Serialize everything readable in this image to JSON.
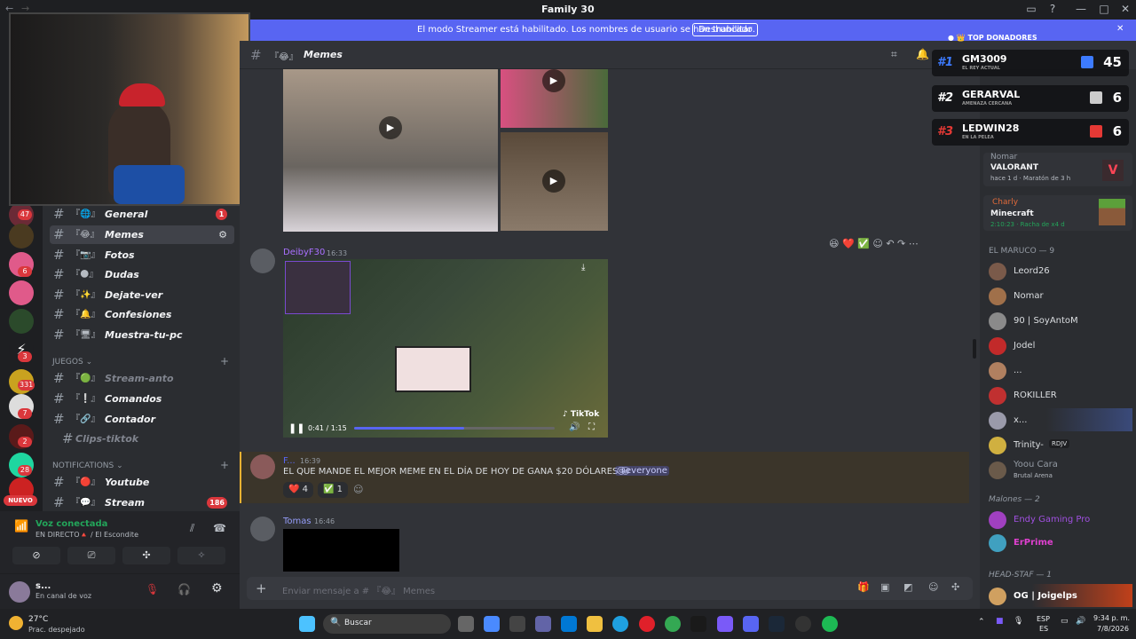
{
  "window": {
    "title": "Family 30"
  },
  "banner": {
    "text": "El modo Streamer está habilitado. Los nombres de usuario se han truncado.",
    "button": "Deshabilitar"
  },
  "header": {
    "channel": "Memes"
  },
  "channels": {
    "items": [
      {
        "emoji": "『🌐』",
        "name": "General",
        "badge": "1"
      },
      {
        "emoji": "『😂』",
        "name": "Memes"
      },
      {
        "emoji": "『📷』",
        "name": "Fotos"
      },
      {
        "emoji": "『🌑』",
        "name": "Dudas"
      },
      {
        "emoji": "『✨』",
        "name": "Dejate-ver"
      },
      {
        "emoji": "『🔔』",
        "name": "Confesiones"
      },
      {
        "emoji": "『🖥』",
        "name": "Muestra-tu-pc"
      }
    ],
    "juegos_label": "JUEGOS",
    "juegos": [
      {
        "emoji": "『🟢』",
        "name": "Stream-anto"
      },
      {
        "emoji": "『❕』",
        "name": "Comandos"
      },
      {
        "emoji": "『🔗』",
        "name": "Contador"
      },
      {
        "emoji": "",
        "name": "Clips-tiktok"
      }
    ],
    "notifications_label": "NOTIFICATIONS",
    "notifications": [
      {
        "emoji": "『🔴』",
        "name": "Youtube"
      },
      {
        "emoji": "『💬』",
        "name": "Stream",
        "badge": "186"
      }
    ]
  },
  "server_badges": [
    "47",
    "6",
    "3",
    "331",
    "7",
    "2",
    "28"
  ],
  "new_label": "NUEVO",
  "voice": {
    "status": "Voz conectada",
    "detail": "EN DIRECTO🔺 / El Escondite"
  },
  "user": {
    "name": "s...",
    "status": "En canal de voz"
  },
  "messages": [
    {
      "author": "DeibyF30",
      "time": "16:33",
      "video_time": "0:41 / 1:15"
    },
    {
      "author": "F...",
      "time": "16:39",
      "text": "EL QUE MANDE EL MEJOR MEME EN EL DÍA DE HOY DE GANA $20 DÓLARES 😀",
      "mention": "@everyone",
      "reactions": [
        {
          "emoji": "❤️",
          "count": "4"
        },
        {
          "emoji": "✅",
          "count": "1"
        }
      ]
    },
    {
      "author": "Tomas",
      "time": "16:46"
    }
  ],
  "composer": {
    "placeholder": "Enviar mensaje a # 『😂』 Memes"
  },
  "donors": {
    "title": "TOP DONADORES",
    "list": [
      {
        "rank": "#1",
        "name": "GM3009",
        "sub": "EL REY ACTUAL",
        "value": "45",
        "color": "#3d7bff"
      },
      {
        "rank": "#2",
        "name": "GERARVAL",
        "sub": "AMENAZA CERCANA",
        "value": "6",
        "color": "#ffffff"
      },
      {
        "rank": "#3",
        "name": "LEDWIN28",
        "sub": "EN LA PELEA",
        "value": "6",
        "color": "#e53935"
      }
    ]
  },
  "members": {
    "activity": [
      {
        "name": "Nomar",
        "game": "VALORANT",
        "detail": "hace 1 d · Maratón de 3 h"
      },
      {
        "name": "Charly",
        "game": "Minecraft",
        "detail": "2:10:23 · Racha de x4 d"
      }
    ],
    "group1": "EL MARUCO — 9",
    "group1_members": [
      "Leord26",
      "Nomar",
      "90 | SoyAntoM",
      "Jodel",
      "...",
      "ROKILLER",
      "x...",
      "Trinity-",
      "Yoou Cara"
    ],
    "group1_extras": {
      "rdjv": "RDJV",
      "arena": "Brutal Arena"
    },
    "group2": "Malones — 2",
    "group2_members": [
      "Endy Gaming Pro",
      "ErPrime"
    ],
    "group3": "HEAD-STAF — 1",
    "group3_members": [
      "OG | Joigelps"
    ]
  },
  "taskbar": {
    "weather": "27°C",
    "weather_desc": "Prac. despejado",
    "search": "Buscar",
    "lang1": "ESP",
    "lang2": "ES",
    "time": "9:34 p. m.",
    "date": "7/8/2026"
  }
}
